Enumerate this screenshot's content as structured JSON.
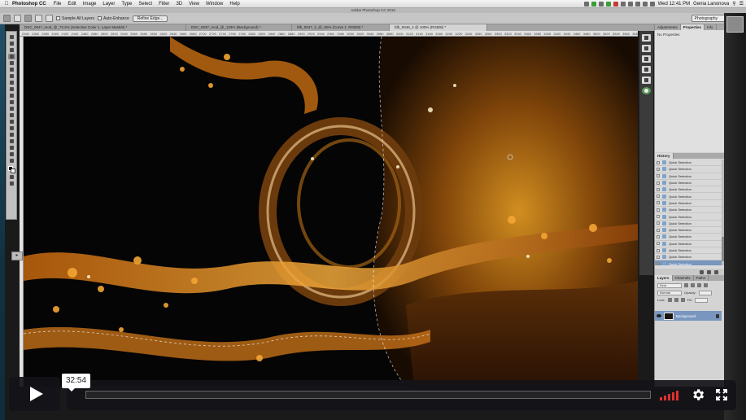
{
  "menubar": {
    "apple": "",
    "app": "Photoshop CC",
    "items": [
      "File",
      "Edit",
      "Image",
      "Layer",
      "Type",
      "Select",
      "Filter",
      "3D",
      "View",
      "Window",
      "Help"
    ],
    "clock": "Wed 12:41 PM",
    "user": "Genia Lanonova"
  },
  "app_title": "Adobe Photoshop CC 2015",
  "options": {
    "sample_all_layers": "Sample All Layers",
    "auto_enhance": "Auto-Enhance",
    "refine_edge": "Refine Edge...",
    "workspace": "Photography"
  },
  "doc_tabs": [
    {
      "label": "DSC_0047_mod_@_73.2% (Selective Color 1, Layer Mask/8) *"
    },
    {
      "label": "DSC_0037_mod_@_133% (Background) *"
    },
    {
      "label": "bfb_0047_2_@_50% (Curve 1, RGB/8) *"
    },
    {
      "label": "bfb_0046_2 @ 100% (RGB/8) *"
    }
  ],
  "ruler_ticks": [
    "2340",
    "2360",
    "2380",
    "2400",
    "2420",
    "2440",
    "2460",
    "2480",
    "2500",
    "2520",
    "2540",
    "2560",
    "2580",
    "2600",
    "2620",
    "2640",
    "2660",
    "2680",
    "2700",
    "2720",
    "2740",
    "2760",
    "2780",
    "2800",
    "2820",
    "2840",
    "2860",
    "2880",
    "2900",
    "2920",
    "2940",
    "2960",
    "2980",
    "3000",
    "3020",
    "3040",
    "3060",
    "3080",
    "3100",
    "3120",
    "3140",
    "3160",
    "3180",
    "3200",
    "3220",
    "3240",
    "3260",
    "3280",
    "3300",
    "3320",
    "3340",
    "3360",
    "3380",
    "3400",
    "3420",
    "3440",
    "3460",
    "3480",
    "3500",
    "3520",
    "3540",
    "3560",
    "3580",
    "3600"
  ],
  "panels": {
    "top_tabs": [
      "Adjustments",
      "Properties",
      "Info"
    ],
    "properties_text": "No Properties",
    "history_tab": "History",
    "history_items": [
      "Quick Selection",
      "Quick Selection",
      "Quick Selection",
      "Quick Selection",
      "Quick Selection",
      "Quick Selection",
      "Quick Selection",
      "Quick Selection",
      "Quick Selection",
      "Quick Selection",
      "Quick Selection",
      "Quick Selection",
      "Quick Selection",
      "Quick Selection",
      "Quick Selection",
      "Quick Selection"
    ],
    "layers_tabs": [
      "Layers",
      "Channels",
      "Paths"
    ],
    "layers_kind": "Kind",
    "layers_blend": "Normal",
    "layers_opacity_label": "Opacity:",
    "layers_lock_label": "Lock:",
    "layers_fill_label": "Fill:",
    "layer_name": "Background"
  },
  "player": {
    "timecode": "32:54",
    "progress": 0.0,
    "accent": "#e03030"
  }
}
